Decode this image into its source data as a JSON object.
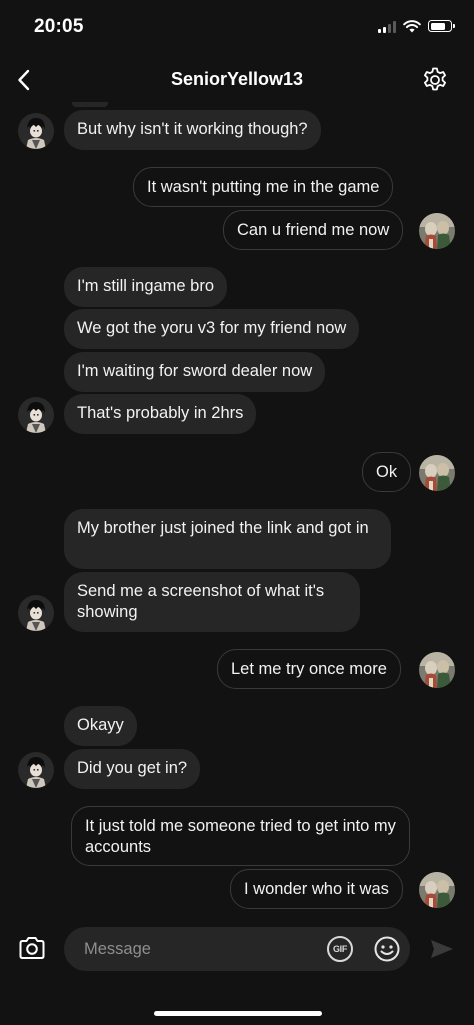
{
  "status_bar": {
    "time": "20:05",
    "battery_level": 0.8,
    "icons": [
      "signal-icon",
      "wifi-icon",
      "battery-icon"
    ]
  },
  "header": {
    "title": "SeniorYellow13",
    "back_icon": "chevron-left-icon",
    "settings_icon": "gear-icon"
  },
  "messages": [
    {
      "direction": "in",
      "text": "But why isn't it working though?"
    },
    {
      "direction": "out",
      "text": "It wasn't putting me in the game"
    },
    {
      "direction": "out",
      "text": "Can u friend me now"
    },
    {
      "direction": "in",
      "text": "I'm still ingame bro"
    },
    {
      "direction": "in",
      "text": "We got the yoru v3 for my friend now"
    },
    {
      "direction": "in",
      "text": "I'm waiting for sword dealer now"
    },
    {
      "direction": "in",
      "text": "That's probably in 2hrs"
    },
    {
      "direction": "out",
      "text": "Ok"
    },
    {
      "direction": "in",
      "text": "My brother just joined the link and got in"
    },
    {
      "direction": "in",
      "text": "Send me a screenshot of what it's showing"
    },
    {
      "direction": "out",
      "text": "Let me try once more"
    },
    {
      "direction": "in",
      "text": "Okayy"
    },
    {
      "direction": "in",
      "text": "Did you get in?"
    },
    {
      "direction": "out",
      "text": "It just told me someone tried to get into my accounts"
    },
    {
      "direction": "out",
      "text": "I wonder who it was"
    }
  ],
  "composer": {
    "placeholder": "Message",
    "gif_label": "GIF",
    "camera_icon": "camera-icon",
    "sticker_icon": "sticker-smiley-icon",
    "send_icon": "send-arrow-icon"
  },
  "colors": {
    "background": "#121212",
    "incoming_bubble": "#262626",
    "outgoing_border": "#3a3a3a",
    "text": "#f2f2f2",
    "placeholder": "#8e8e8e"
  }
}
